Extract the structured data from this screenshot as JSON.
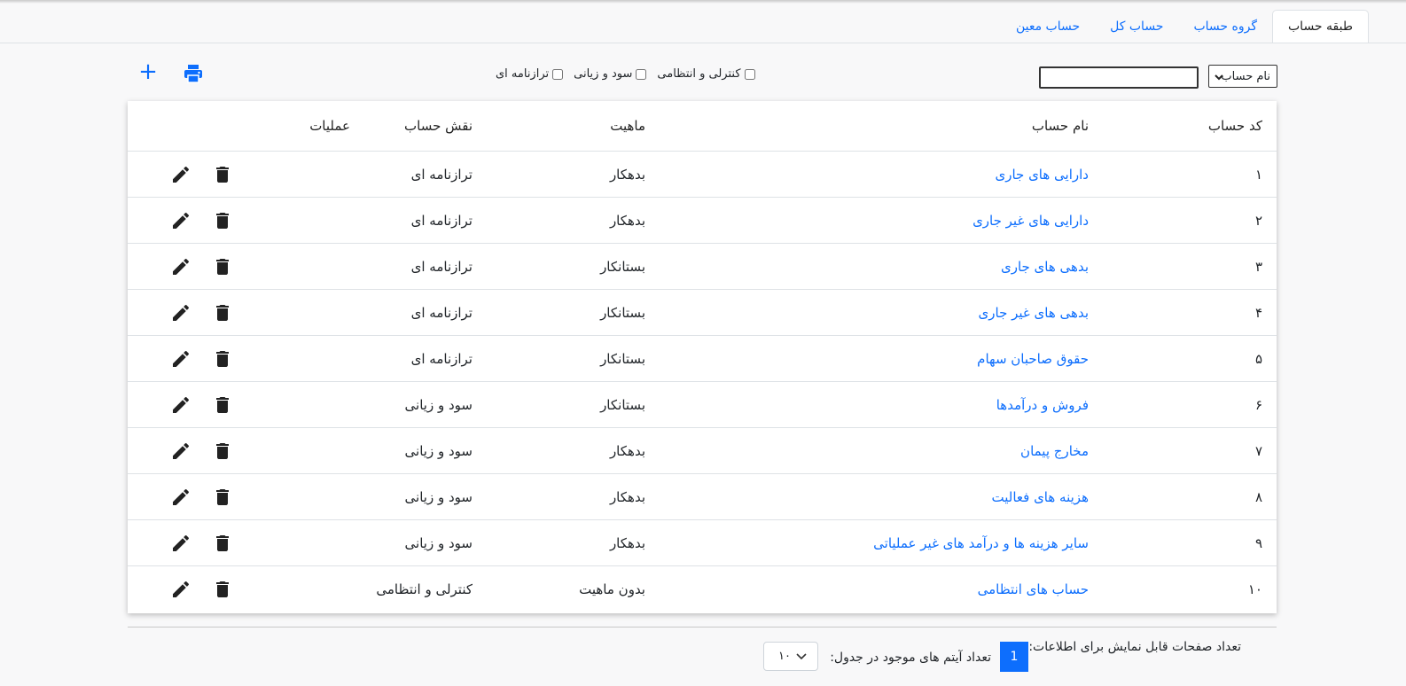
{
  "tabs": [
    {
      "label": "طبقه حساب",
      "active": true
    },
    {
      "label": "گروه حساب",
      "active": false
    },
    {
      "label": "حساب کل",
      "active": false
    },
    {
      "label": "حساب معین",
      "active": false
    }
  ],
  "toolbar": {
    "search_field_select": "نام حساب",
    "search_value": "",
    "filters": [
      {
        "label": "ترازنامه ای",
        "checked": false
      },
      {
        "label": "سود و زیانی",
        "checked": false
      },
      {
        "label": "کنترلی و انتظامی",
        "checked": false
      }
    ],
    "print_icon": "printer-icon",
    "add_label": "+"
  },
  "table": {
    "headers": {
      "code": "کد حساب",
      "name": "نام حساب",
      "nature": "ماهیت",
      "role": "نقش حساب",
      "ops": "عملیات"
    },
    "rows": [
      {
        "code": "۱",
        "name": "دارایی های جاری",
        "nature": "بدهکار",
        "role": "ترازنامه ای"
      },
      {
        "code": "۲",
        "name": "دارایی های غیر جاری",
        "nature": "بدهکار",
        "role": "ترازنامه ای"
      },
      {
        "code": "۳",
        "name": "بدهی های جاری",
        "nature": "بستانکار",
        "role": "ترازنامه ای"
      },
      {
        "code": "۴",
        "name": "بدهی های غیر جاری",
        "nature": "بستانکار",
        "role": "ترازنامه ای"
      },
      {
        "code": "۵",
        "name": "حقوق صاحبان سهام",
        "nature": "بستانکار",
        "role": "ترازنامه ای"
      },
      {
        "code": "۶",
        "name": "فروش و درآمدها",
        "nature": "بستانکار",
        "role": "سود و زیانی"
      },
      {
        "code": "۷",
        "name": "مخارج پیمان",
        "nature": "بدهکار",
        "role": "سود و زیانی"
      },
      {
        "code": "۸",
        "name": "هزینه های فعالیت",
        "nature": "بدهکار",
        "role": "سود و زیانی"
      },
      {
        "code": "۹",
        "name": "سایر هزینه ها و درآمد های غیر عملیاتی",
        "nature": "بدهکار",
        "role": "سود و زیانی"
      },
      {
        "code": "۱۰",
        "name": "حساب های انتظامی",
        "nature": "بدون ماهیت",
        "role": "کنترلی و انتظامی"
      }
    ]
  },
  "footer": {
    "pages_label": "تعداد صفحات قابل نمایش برای اطلاعات:",
    "current_page": "1",
    "items_label": "تعداد آیتم های موجود در جدول:",
    "per_page": "۱۰"
  }
}
